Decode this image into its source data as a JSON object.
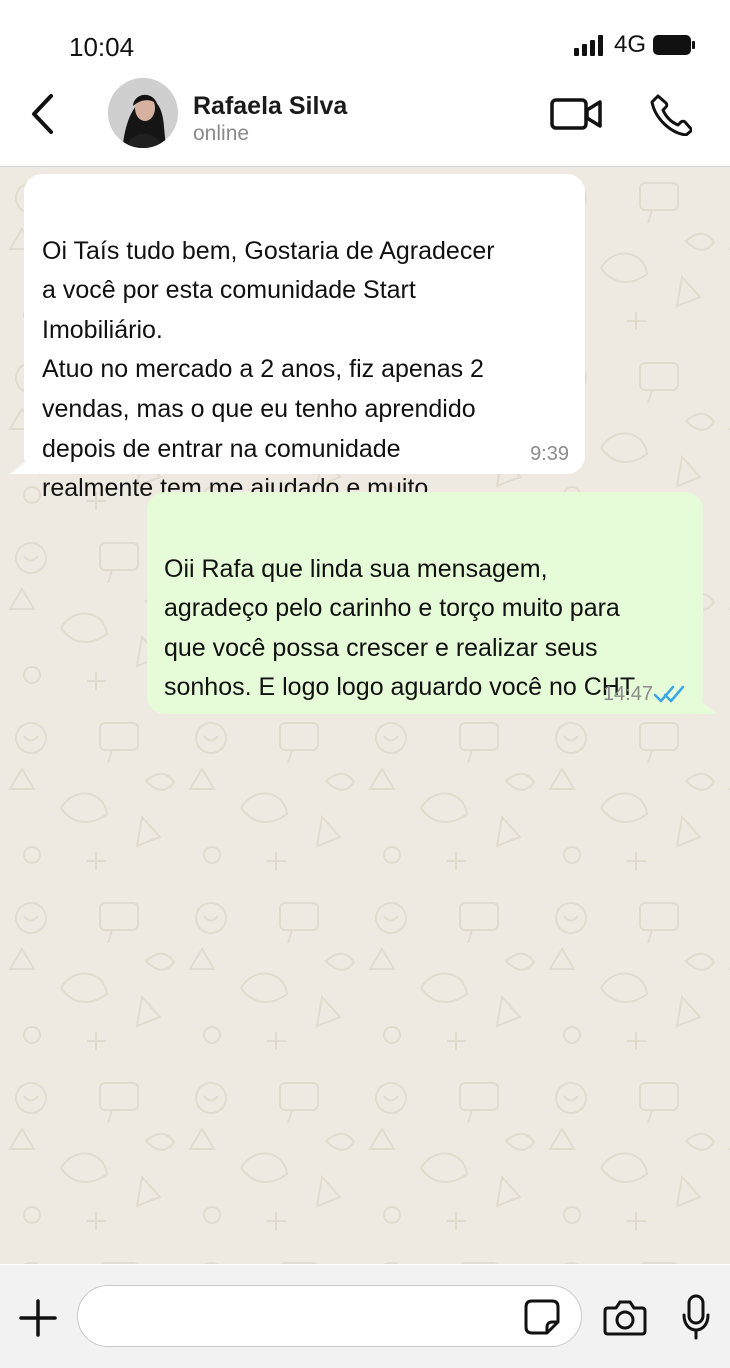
{
  "status_bar": {
    "time": "10:04",
    "network": "4G",
    "icons": [
      "signal-bars-icon",
      "battery-icon"
    ]
  },
  "header": {
    "contact_name": "Rafaela Silva",
    "contact_status": "online",
    "icons": [
      "back-arrow-icon",
      "video-call-icon",
      "phone-call-icon"
    ]
  },
  "messages": [
    {
      "direction": "incoming",
      "text": "Oi Taís tudo bem, Gostaria de Agradecer\na você por esta comunidade Start\nImobiliário.\nAtuo no mercado a 2 anos, fiz apenas 2\nvendas, mas o que eu tenho aprendido\ndepois de entrar na comunidade\nrealmente tem me ajudado e muito.",
      "time": "9:39"
    },
    {
      "direction": "outgoing",
      "text": "Oii Rafa que linda sua mensagem,\nagradeço pelo carinho e torço muito para\nque você possa crescer e realizar seus\nsonhos. E logo logo aguardo você no CHT",
      "time": "14:47",
      "status_icon": "double-check-read-icon"
    }
  ],
  "composer": {
    "input_value": "",
    "placeholder": "",
    "icons": [
      "plus-icon",
      "sticker-icon",
      "camera-icon",
      "microphone-icon"
    ]
  },
  "colors": {
    "chat_background": "#efeae1",
    "incoming_bubble": "#ffffff",
    "outgoing_bubble": "#e6fbd7",
    "read_tick": "#3aa7e8"
  }
}
